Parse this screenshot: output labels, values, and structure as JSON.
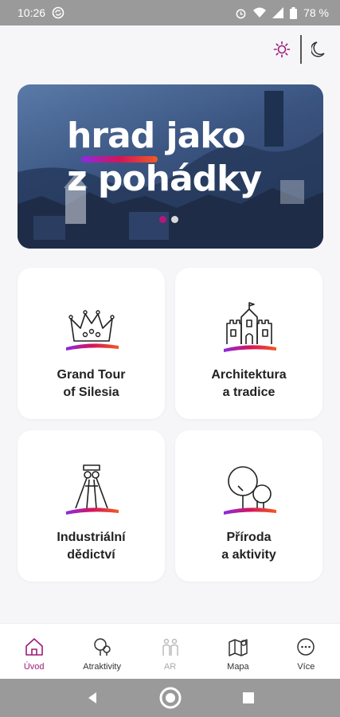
{
  "status_bar": {
    "time": "10:26",
    "battery": "78 %"
  },
  "theme_toggle": {
    "light_icon": "sun-icon",
    "dark_icon": "moon-icon"
  },
  "banner": {
    "line1": "hrad jako",
    "line2": "z pohádky",
    "slides_total": 2,
    "active_slide": 1
  },
  "categories": [
    {
      "line1": "Grand Tour",
      "line2": "of Silesia",
      "icon": "crown-icon"
    },
    {
      "line1": "Architektura",
      "line2": "a tradice",
      "icon": "castle-icon"
    },
    {
      "line1": "Industriální",
      "line2": "dědictví",
      "icon": "mining-tower-icon"
    },
    {
      "line1": "Příroda",
      "line2": "a aktivity",
      "icon": "trees-icon"
    }
  ],
  "bottom_nav": [
    {
      "label": "Úvod",
      "icon": "home-icon",
      "state": "active"
    },
    {
      "label": "Atraktivity",
      "icon": "tree-icon",
      "state": "normal"
    },
    {
      "label": "AR",
      "icon": "ar-icon",
      "state": "disabled"
    },
    {
      "label": "Mapa",
      "icon": "map-icon",
      "state": "normal"
    },
    {
      "label": "Více",
      "icon": "more-icon",
      "state": "normal"
    }
  ],
  "colors": {
    "accent": "#9b1c7a",
    "gradient_start": "#8a2be2",
    "gradient_mid": "#d4145a",
    "gradient_end": "#f15a24"
  }
}
